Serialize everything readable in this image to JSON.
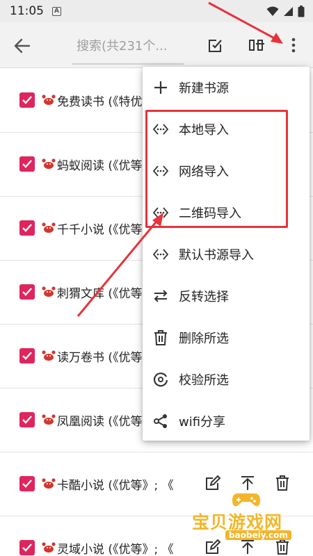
{
  "status_bar": {
    "time": "11:05",
    "notif_letter": "A"
  },
  "toolbar": {
    "search_placeholder": "搜索(共231个..."
  },
  "rows": [
    {
      "name": "免费读书 (《特优"
    },
    {
      "name": "蚂蚁阅读 (《优等"
    },
    {
      "name": "千千小说 (《优等"
    },
    {
      "name": "刺猬文库 (《优等"
    },
    {
      "name": "读万卷书 (《优等"
    },
    {
      "name": "凤凰阅读 (《优等"
    },
    {
      "name": "卡酷小说 (《优等》; 《"
    },
    {
      "name": "灵域小说 (《优等》; 《"
    }
  ],
  "menu": {
    "items": [
      {
        "label": "新建书源",
        "icon": "plus-icon"
      },
      {
        "label": "本地导入",
        "icon": "code-diamond-icon"
      },
      {
        "label": "网络导入",
        "icon": "code-diamond-icon"
      },
      {
        "label": "二维码导入",
        "icon": "code-diamond-icon"
      },
      {
        "label": "默认书源导入",
        "icon": "code-diamond-icon"
      },
      {
        "label": "反转选择",
        "icon": "swap-icon"
      },
      {
        "label": "删除所选",
        "icon": "trash-icon"
      },
      {
        "label": "校验所选",
        "icon": "check-circle-icon"
      },
      {
        "label": "wifi分享",
        "icon": "share-icon"
      }
    ]
  },
  "watermark": {
    "title": "宝贝游戏网",
    "url": "baobeiy.com"
  },
  "colors": {
    "accent": "#e0245e",
    "annotation": "#e8323c",
    "watermark": "#f3b62a"
  }
}
